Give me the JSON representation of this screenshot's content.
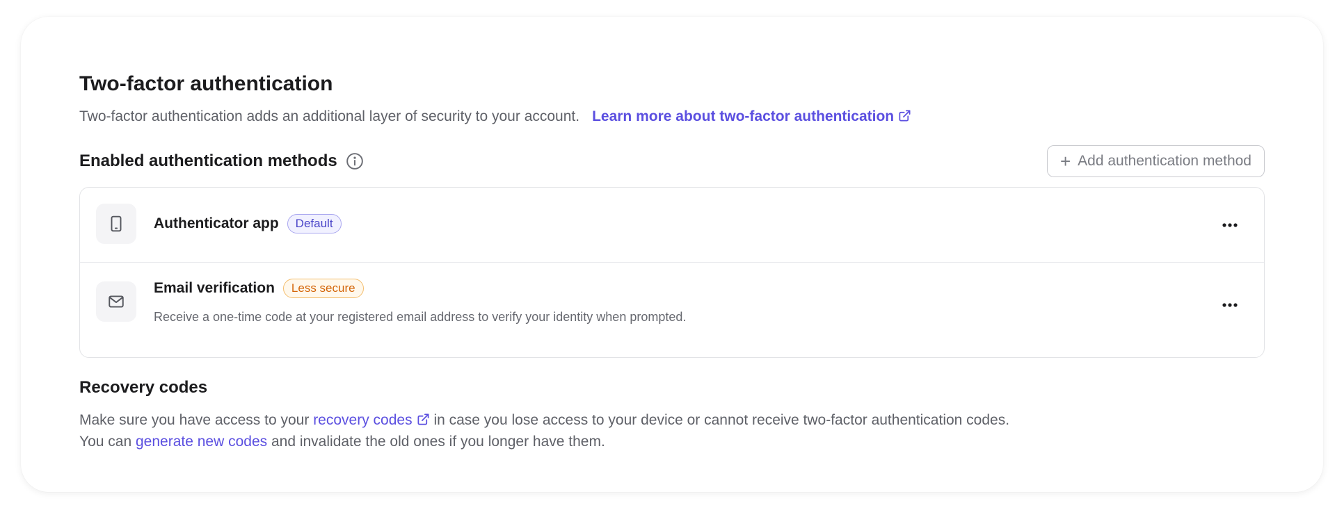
{
  "header": {
    "title": "Two-factor authentication",
    "description": "Two-factor authentication adds an additional layer of security to your account.",
    "learn_more_label": "Learn more about two-factor authentication"
  },
  "methods_section": {
    "title": "Enabled authentication methods",
    "add_button_label": "Add authentication method",
    "items": [
      {
        "name": "Authenticator app",
        "badge": "Default",
        "icon": "smartphone-icon"
      },
      {
        "name": "Email verification",
        "badge": "Less secure",
        "description": "Receive a one-time code at your registered email address to verify your identity when prompted.",
        "icon": "mail-icon"
      }
    ]
  },
  "recovery": {
    "title": "Recovery codes",
    "line1_prefix": "Make sure you have access to your",
    "line1_link": "recovery codes",
    "line1_suffix": "in case you lose access to your device or cannot receive two-factor authentication codes.",
    "line2_prefix": "You can",
    "line2_link": "generate new codes",
    "line2_suffix": "and invalidate the old ones if you longer have them."
  },
  "colors": {
    "accent": "#5b4fe0",
    "default_badge": "#4a45c8",
    "warning_badge": "#d4660a",
    "text_primary": "#1c1c1e",
    "text_secondary": "#5f6168"
  }
}
